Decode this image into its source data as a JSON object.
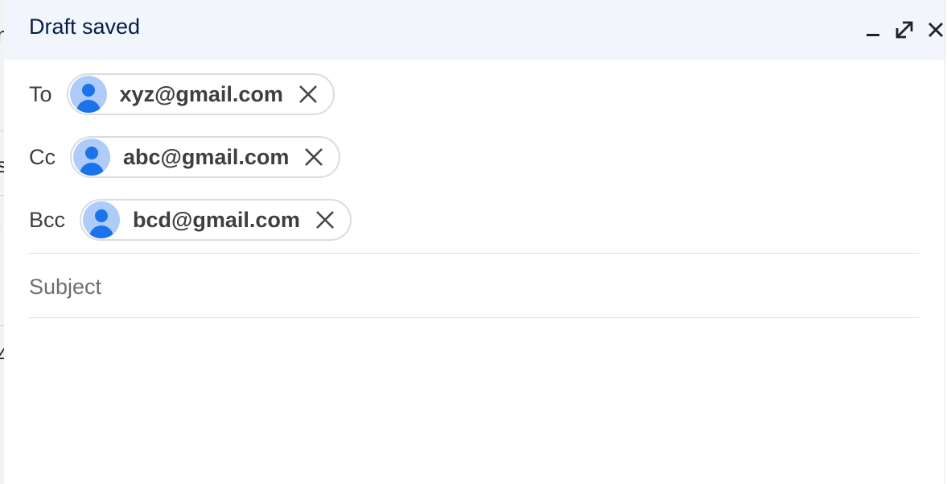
{
  "compose": {
    "title": "Draft saved",
    "controls": {
      "minimize_icon": "minimize-icon",
      "expand_icon": "full-screen-icon",
      "close_icon": "close-icon"
    },
    "recipients": {
      "to": {
        "label": "To",
        "chips": [
          {
            "email": "xyz@gmail.com",
            "avatar_icon": "person-avatar-icon",
            "remove_icon": "close-icon"
          }
        ]
      },
      "cc": {
        "label": "Cc",
        "chips": [
          {
            "email": "abc@gmail.com",
            "avatar_icon": "person-avatar-icon",
            "remove_icon": "close-icon"
          }
        ]
      },
      "bcc": {
        "label": "Bcc",
        "chips": [
          {
            "email": "bcd@gmail.com",
            "avatar_icon": "person-avatar-icon",
            "remove_icon": "close-icon"
          }
        ]
      }
    },
    "subject": {
      "value": "",
      "placeholder": "Subject"
    },
    "colors": {
      "header_bg": "#f2f6fc",
      "title": "#041e49",
      "avatar_bg": "#aecbfa",
      "avatar_fg": "#1a73e8",
      "chip_border": "#dadce0"
    }
  }
}
